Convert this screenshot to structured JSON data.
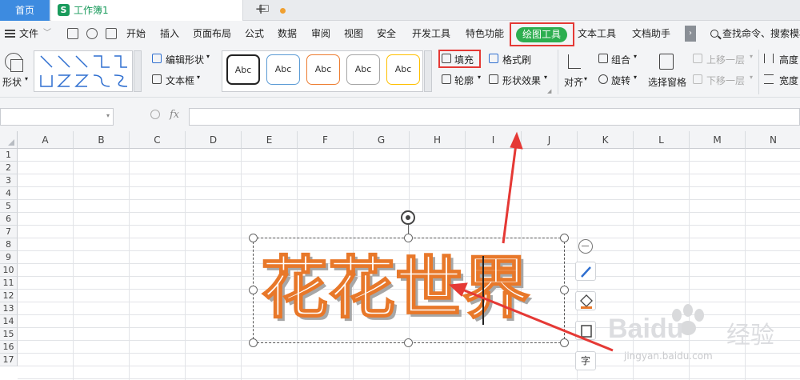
{
  "tabs": {
    "home": "首页",
    "doc_title": "工作簿1",
    "doc_logo": "S",
    "add": "+"
  },
  "menu": {
    "file": "文件",
    "items": [
      "开始",
      "插入",
      "页面布局",
      "公式",
      "数据",
      "审阅",
      "视图",
      "安全",
      "开发工具",
      "特色功能",
      "绘图工具",
      "文本工具",
      "文档助手"
    ],
    "search": "查找命令、搜索模板"
  },
  "ribbon": {
    "shape": "形状",
    "edit_shape": "编辑形状",
    "text_box": "文本框",
    "style_presets": [
      "Abc",
      "Abc",
      "Abc",
      "Abc",
      "Abc"
    ],
    "style_colors": [
      "#222222",
      "#5b9bd5",
      "#ed7d31",
      "#a5a5a5",
      "#ffc000"
    ],
    "fill": "填充",
    "format_painter": "格式刷",
    "outline": "轮廓",
    "shape_effects": "形状效果",
    "align": "对齐",
    "group": "组合",
    "rotate": "旋转",
    "selection_pane": "选择窗格",
    "bring_forward": "上移一层",
    "send_backward": "下移一层",
    "height": "高度",
    "width": "宽度"
  },
  "formula": {
    "fx": "fx"
  },
  "grid": {
    "columns": [
      "A",
      "B",
      "C",
      "D",
      "E",
      "F",
      "G",
      "H",
      "I",
      "J",
      "K",
      "L",
      "M",
      "N"
    ],
    "rows": [
      "1",
      "2",
      "3",
      "4",
      "5",
      "6",
      "7",
      "8",
      "9",
      "10",
      "11",
      "12",
      "13",
      "14",
      "15",
      "16",
      "17"
    ]
  },
  "art_text": "花花世界",
  "float_toolbar": {
    "text_btn": "字"
  },
  "watermark": {
    "brand": "Baidu",
    "brand_cn": "经验",
    "url": "jingyan.baidu.com"
  },
  "colors": {
    "accent_tab": "#3d8be0",
    "draw_tab": "#2cae4f",
    "highlight": "#e53935",
    "text_stroke": "#e8782a"
  }
}
